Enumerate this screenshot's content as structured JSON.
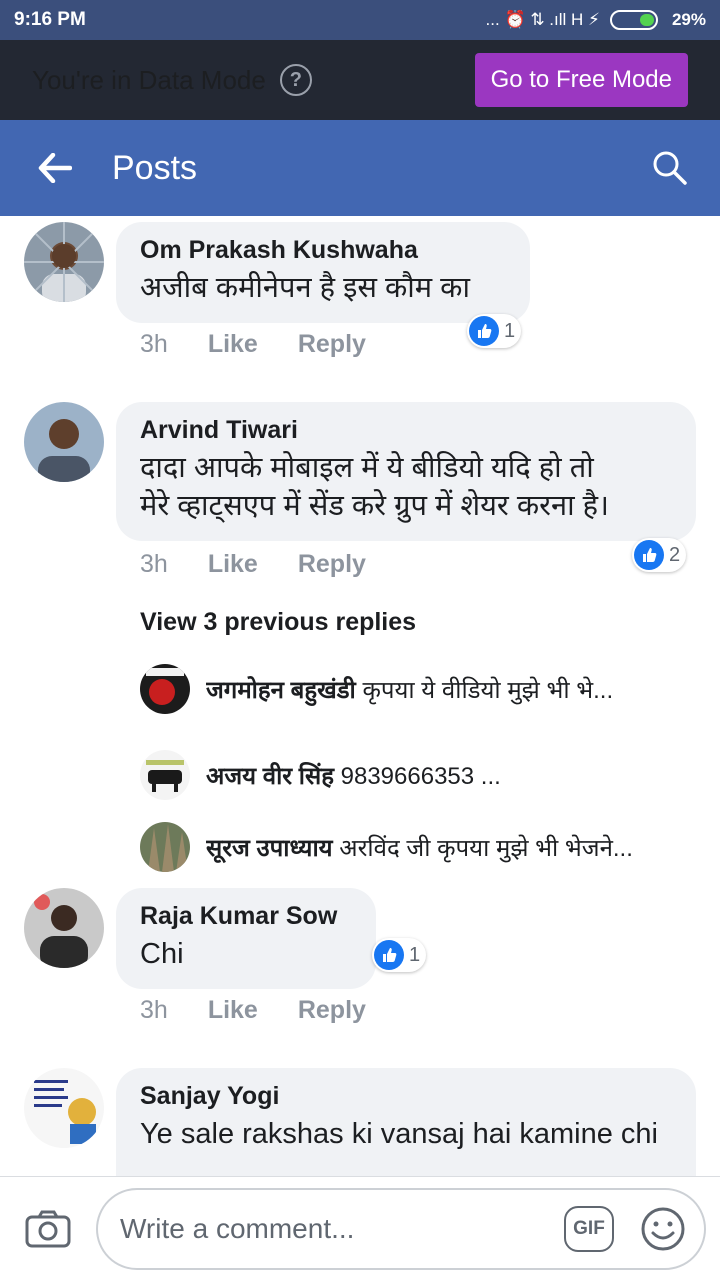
{
  "status_bar": {
    "time": "9:16 PM",
    "indicators": "... ⏰ ⇅ .ıll H ⚡",
    "battery": "29%",
    "battery_level": 0.29
  },
  "data_banner": {
    "text": "You're in Data Mode",
    "help_icon": "question-circle-icon",
    "button": "Go to Free Mode",
    "button_color": "#9b37c1"
  },
  "nav": {
    "title": "Posts",
    "back_icon": "arrow-left-icon",
    "search_icon": "search-icon",
    "color": "#4267b2"
  },
  "comments": [
    {
      "author": "Om Prakash Kushwaha",
      "text": "अजीब कमीनेपन है इस कौम का",
      "time": "3h",
      "like": "Like",
      "reply": "Reply",
      "reactions": "1"
    },
    {
      "author": "Arvind Tiwari",
      "text_line1": "दादा आपके मोबाइल में ये बीडियो यदि हो तो",
      "text_line2": "मेरे व्हाट्सएप में सेंड करे ग्रुप में शेयर करना है।",
      "time": "3h",
      "like": "Like",
      "reply": "Reply",
      "reactions": "2",
      "view_previous": "View 3 previous replies",
      "replies": [
        {
          "name": "जगमोहन बहुखंडी",
          "text": "कृपया ये वीडियो मुझे भी भे..."
        },
        {
          "name": "अजय वीर सिंह",
          "text": "9839666353 ..."
        },
        {
          "name": "सूरज उपाध्याय",
          "text": "अरविंद जी कृपया मुझे भी भेजने..."
        }
      ]
    },
    {
      "author": "Raja Kumar Sow",
      "text": "Chi",
      "time": "3h",
      "like": "Like",
      "reply": "Reply",
      "reactions": "1"
    },
    {
      "author": "Sanjay Yogi",
      "text": "Ye sale rakshas ki vansaj hai kamine chi"
    }
  ],
  "composer": {
    "placeholder": "Write a comment...",
    "camera_icon": "camera-icon",
    "gif_label": "GIF",
    "emoji_icon": "smiley-icon"
  }
}
